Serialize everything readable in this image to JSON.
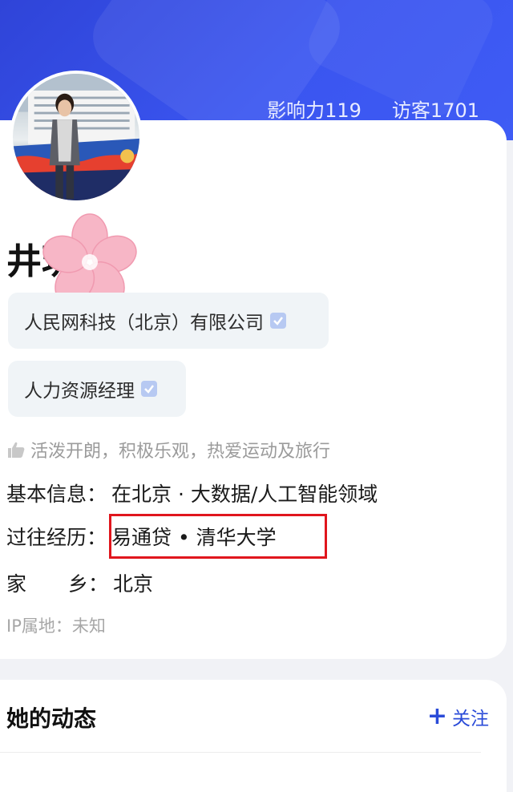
{
  "stats": {
    "influence": "影响力119",
    "visitors": "访客1701"
  },
  "profile": {
    "name": "井玥",
    "company_tag": "人民网科技（北京）有限公司",
    "title_tag": "人力资源经理",
    "motto": "活泼开朗，积极乐观，热爱运动及旅行",
    "basic_info_label": "基本信息：",
    "basic_info_value": "在北京 · 大数据/人工智能领域",
    "experience_label": "过往经历：",
    "experience_value": "易通贷 • 清华大学",
    "hometown_label_a": "家",
    "hometown_label_b": "乡：",
    "hometown_value": "北京",
    "ip_location": "IP属地：未知"
  },
  "feed": {
    "title": "她的动态",
    "follow_label": "关注"
  },
  "colors": {
    "banner": "#3a55f0",
    "accent_blue": "#2a4bd8",
    "highlight_red": "#e0161d"
  }
}
